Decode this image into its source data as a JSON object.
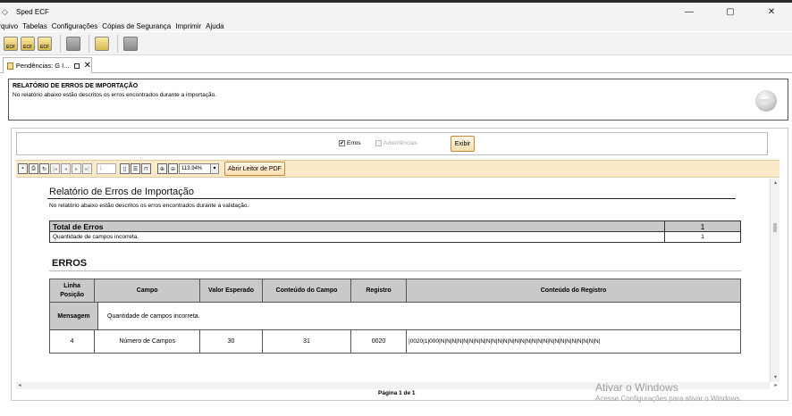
{
  "window": {
    "title": "Sped ECF",
    "controls": [
      "—",
      "▢",
      "✕"
    ]
  },
  "menu": [
    "Arquivo",
    "Tabelas",
    "Configurações",
    "Cópias de Segurança",
    "Imprimir",
    "Ajuda"
  ],
  "toolbar": {
    "icons": [
      {
        "name": "ecf-icon-1",
        "label": "ECF"
      },
      {
        "name": "ecf-icon-2",
        "label": "ECF"
      },
      {
        "name": "ecf-icon-3",
        "label": "ECF"
      },
      {
        "name": "folder-icon"
      },
      {
        "name": "edit-document-icon"
      },
      {
        "name": "report-icon"
      }
    ]
  },
  "tab": {
    "label": "Pendências: G I..."
  },
  "header": {
    "title": "RELATÓRIO DE ERROS DE IMPORTAÇÃO",
    "description": "No relatório abaixo estão descritos os erros encontrados durante a importação."
  },
  "options": {
    "erros_label": "Erros",
    "erros_checked": true,
    "advertencias_label": "Advertências",
    "advertencias_checked": false,
    "exibir_label": "Exibir"
  },
  "viewer": {
    "page_value": "1",
    "zoom": "113.94%",
    "open_pdf_label": "Abrir Leitor de PDF"
  },
  "report": {
    "title": "Relatório de Erros de Importação",
    "description": "No relatório abaixo estão descritos os erros encontrados durante a validação.",
    "total_label": "Total de Erros",
    "total_value": "1",
    "total_row_label": "Quantidade de campos incorreta.",
    "total_row_value": "1",
    "erros_title": "ERROS",
    "columns": [
      "Linha Posição",
      "Campo",
      "Valor Esperado",
      "Conteúdo do Campo",
      "Registro",
      "Conteúdo do Registro"
    ],
    "message_label": "Mensagem",
    "message_text": "Quantidade de campos incorreta.",
    "row": {
      "linha": "4",
      "campo": "Número de Campos",
      "valor_esperado": "30",
      "conteudo_campo": "31",
      "registro": "0020",
      "conteudo_registro": "|0020|1|000|N|N|N|N|N|N|N|N|N|N|N|N|N|N|N|N|N|N|N|N|N|N|N|N|N|N|N|N|"
    }
  },
  "page_indicator": "Página 1 de 1",
  "watermark": {
    "title": "Ativar o Windows",
    "subtitle": "Acesse Configurações para ativar o Windows."
  }
}
